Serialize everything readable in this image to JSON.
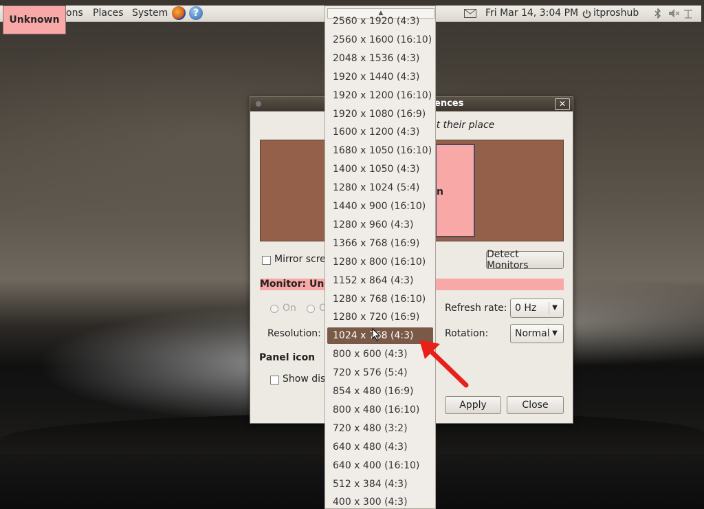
{
  "topbar": {
    "menus": [
      "ons",
      "Places",
      "System"
    ],
    "clock": "Fri Mar 14,  3:04 PM",
    "user": "itproshub",
    "icons": [
      "firefox-icon",
      "help-icon",
      "mail-icon",
      "power-icon",
      "bluetooth-icon",
      "volume-icon",
      "keyboard-icon"
    ]
  },
  "badge": "Unknown",
  "dialog": {
    "title": "ences",
    "subtitle": "et their place",
    "monitor_box_label": "n",
    "mirror_label": "Mirror scree",
    "detect_button": "Detect Monitors",
    "monitor_label": "Monitor: Unk",
    "on_label": "On",
    "off_label": "O",
    "resolution_label": "Resolution:",
    "refresh_label": "Refresh rate:",
    "refresh_value": "0 Hz",
    "rotation_label": "Rotation:",
    "rotation_value": "Normal",
    "panel_icon_heading": "Panel icon",
    "show_display_label": "Show disp",
    "apply_button": "Apply",
    "close_button": "Close"
  },
  "dropdown": {
    "selected_index": 17,
    "items": [
      "2560 x 1920 (4:3)",
      "2560 x 1600 (16:10)",
      "2048 x 1536 (4:3)",
      "1920 x 1440 (4:3)",
      "1920 x 1200 (16:10)",
      "1920 x 1080 (16:9)",
      "1600 x 1200 (4:3)",
      "1680 x 1050 (16:10)",
      "1400 x 1050 (4:3)",
      "1280 x 1024 (5:4)",
      "1440 x 900 (16:10)",
      "1280 x 960 (4:3)",
      "1366 x 768 (16:9)",
      "1280 x 800 (16:10)",
      "1152 x 864 (4:3)",
      "1280 x 768 (16:10)",
      "1280 x 720 (16:9)",
      "1024 x 768 (4:3)",
      "800 x 600 (4:3)",
      "720 x 576 (5:4)",
      "854 x 480 (16:9)",
      "800 x 480 (16:10)",
      "720 x 480 (3:2)",
      "640 x 480 (4:3)",
      "640 x 400 (16:10)",
      "512 x 384 (4:3)",
      "400 x 300 (4:3)"
    ]
  },
  "colors": {
    "selection": "#7a5a47",
    "monitor_area": "#94604a",
    "monitor_pink": "#f9a8a8",
    "annotation_arrow": "#e8201a"
  }
}
